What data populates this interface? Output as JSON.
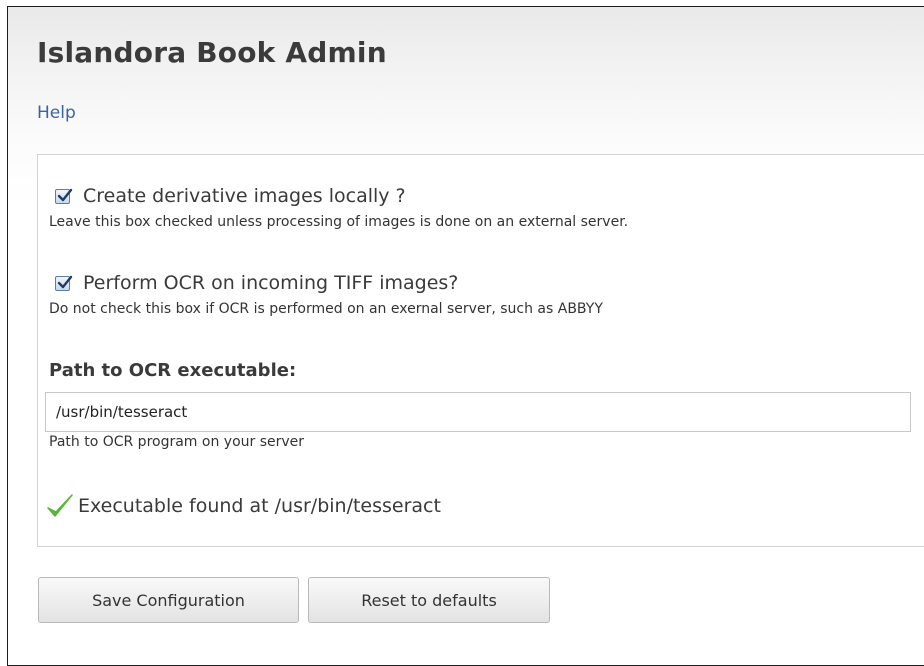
{
  "page": {
    "title": "Islandora Book Admin",
    "help_link": "Help"
  },
  "settings": {
    "derivatives": {
      "label": "Create derivative images locally ?",
      "checked": true,
      "description": "Leave this box checked unless processing of images is done on an external server."
    },
    "ocr": {
      "label": "Perform OCR on incoming TIFF images?",
      "checked": true,
      "description": "Do not check this box if OCR is performed on an exernal server, such as ABBYY"
    },
    "ocr_path": {
      "label": "Path to OCR executable:",
      "value": "/usr/bin/tesseract",
      "description": "Path to OCR program on your server"
    },
    "status": {
      "icon": "checkmark-icon",
      "color": "#5ab33c",
      "text": "Executable found at /usr/bin/tesseract"
    }
  },
  "actions": {
    "save_label": "Save Configuration",
    "reset_label": "Reset to defaults"
  }
}
